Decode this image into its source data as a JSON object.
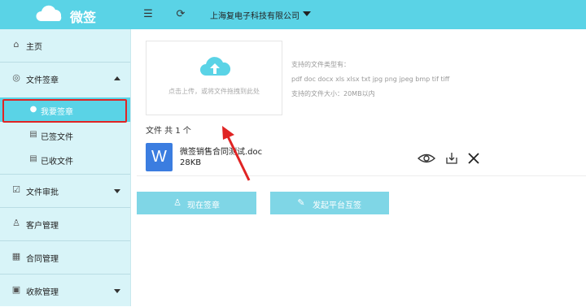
{
  "header": {
    "app_name": "微签",
    "company": "上海复电子科技有限公司",
    "menu_icon": "menu-toggle-icon",
    "refresh_icon": "refresh-icon"
  },
  "sidebar": {
    "items": [
      {
        "label": "主页",
        "icon": "home-icon"
      },
      {
        "label": "文件签章",
        "icon": "signature-icon",
        "expanded": true
      },
      {
        "label": "文件审批",
        "icon": "approval-icon",
        "expanded": false
      },
      {
        "label": "客户管理",
        "icon": "user-icon"
      },
      {
        "label": "合同管理",
        "icon": "contract-icon"
      },
      {
        "label": "收款管理",
        "icon": "payment-icon",
        "expanded": false
      }
    ],
    "sub_items": [
      {
        "label": "我要签章",
        "icon": "user-icon",
        "active": true
      },
      {
        "label": "已签文件",
        "icon": "document-icon"
      },
      {
        "label": "已收文件",
        "icon": "document-icon"
      }
    ]
  },
  "upload": {
    "hint": "点击上传，或将文件拖拽到此处",
    "types_title": "支持的文件类型有：",
    "types": "pdf doc docx xls xlsx txt jpg png jpeg bmp tif tiff",
    "max_size": "支持的文件大小：20MB以内"
  },
  "files": {
    "count_label": "文件 共 1 个",
    "items": [
      {
        "icon_letter": "W",
        "name": "微签销售合同测试.doc",
        "size": "28KB"
      }
    ]
  },
  "actions": {
    "sign_now": "现在签章",
    "platform_sign": "发起平台互签"
  },
  "colors": {
    "accent": "#5ad3e6",
    "button": "#7fd6e6",
    "word_blue": "#3b7de0",
    "annotation_red": "#e02424"
  }
}
